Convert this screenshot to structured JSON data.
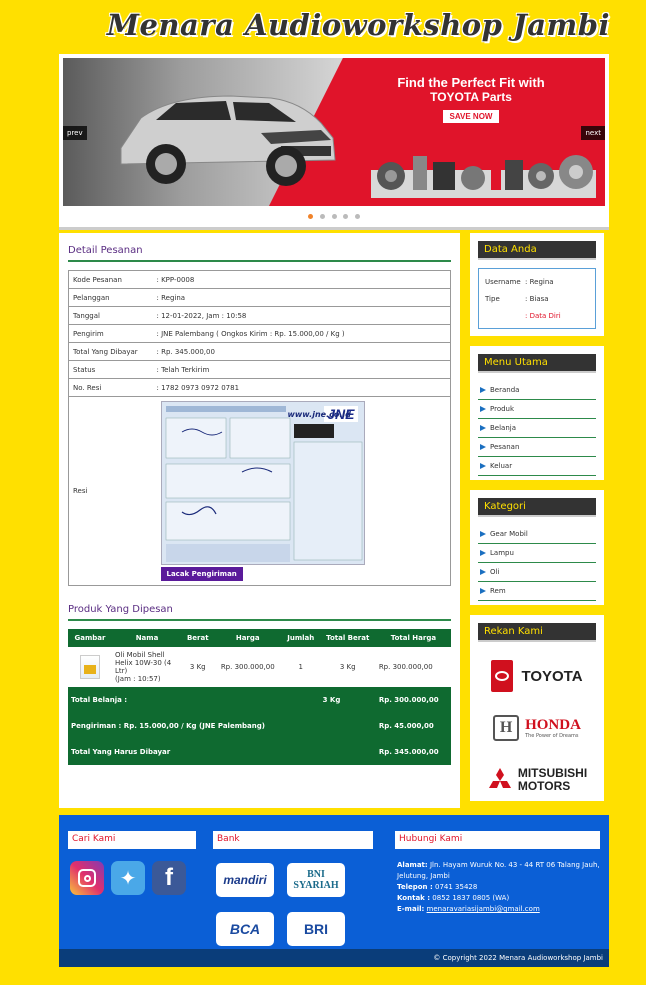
{
  "site": {
    "title": "Menara Audioworkshop Jambi"
  },
  "slider": {
    "promo_line1": "Find the Perfect Fit with",
    "promo_line2": "TOYOTA Parts",
    "promo_button": "SAVE NOW",
    "prev_label": "prev",
    "next_label": "next",
    "dot_count": 5,
    "active_dot": 1
  },
  "detail": {
    "title": "Detail Pesanan",
    "rows": [
      {
        "label": "Kode Pesanan",
        "value": ": KPP-0008"
      },
      {
        "label": "Pelanggan",
        "value": ": Regina"
      },
      {
        "label": "Tanggal",
        "value": ": 12-01-2022, Jam : 10:58"
      },
      {
        "label": "Pengirim",
        "value": ": JNE Palembang ( Ongkos Kirim : Rp. 15.000,00 / Kg )"
      },
      {
        "label": "Total Yang Dibayar",
        "value": ": Rp. 345.000,00"
      },
      {
        "label": "Status",
        "value": ": Telah Terkirim"
      },
      {
        "label": "No. Resi",
        "value": ": 1782 0973 0972 0781"
      }
    ],
    "resi_label": "Resi",
    "resi_logo": "JNE",
    "resi_url": "www.jne.co.id",
    "lacak_button": "Lacak Pengiriman"
  },
  "products": {
    "title": "Produk Yang Dipesan",
    "headers": [
      "Gambar",
      "Nama",
      "Berat",
      "Harga",
      "Jumlah",
      "Total Berat",
      "Total Harga"
    ],
    "item": {
      "name": "Oli Mobil Shell Helix 10W-30 (4 Ltr)",
      "time": "(Jam : 10:57)",
      "weight": "3 Kg",
      "price": "Rp. 300.000,00",
      "qty": "1",
      "total_weight": "3 Kg",
      "total_price": "Rp. 300.000,00"
    },
    "totals": [
      {
        "label": "Total Belanja :",
        "weight": "3 Kg",
        "amount": "Rp. 300.000,00"
      },
      {
        "label": "Pengiriman : Rp. 15.000,00 / Kg (JNE Palembang)",
        "weight": "",
        "amount": "Rp. 45.000,00"
      },
      {
        "label": "Total Yang Harus Dibayar",
        "weight": "",
        "amount": "Rp. 345.000,00"
      }
    ]
  },
  "sidebar": {
    "data_anda": {
      "title": "Data Anda",
      "username_label": "Username",
      "username_value": ": Regina",
      "tipe_label": "Tipe",
      "tipe_value": ": Biasa",
      "data_diri_link": ": Data Diri"
    },
    "menu": {
      "title": "Menu Utama",
      "items": [
        "Beranda",
        "Produk",
        "Belanja",
        "Pesanan",
        "Keluar"
      ]
    },
    "kategori": {
      "title": "Kategori",
      "items": [
        "Gear Mobil",
        "Lampu",
        "Oli",
        "Rem"
      ]
    },
    "rekan": {
      "title": "Rekan Kami",
      "toyota": "TOYOTA",
      "honda": "HONDA",
      "honda_tag": "The Power of Dreams",
      "mitsubishi1": "MITSUBISHI",
      "mitsubishi2": "MOTORS"
    }
  },
  "footer": {
    "cari_title": "Cari Kami",
    "bank_title": "Bank",
    "hubungi_title": "Hubungi Kami",
    "banks": [
      "mandiri",
      "BNI SYARIAH",
      "BCA",
      "BRI"
    ],
    "alamat_label": "Alamat:",
    "alamat_value": "Jln. Hayam Wuruk No. 43 - 44 RT 06 Talang Jauh, Jelutung, Jambi",
    "telepon_label": "Telepon :",
    "telepon_value": "0741 35428",
    "kontak_label": "Kontak :",
    "kontak_value": "0852 1837 0805 (WA)",
    "email_label": "E-mail:",
    "email_value": "menaravariasijambi@gmail.com",
    "copyright": "© Copyright 2022 Menara Audioworkshop Jambi"
  }
}
